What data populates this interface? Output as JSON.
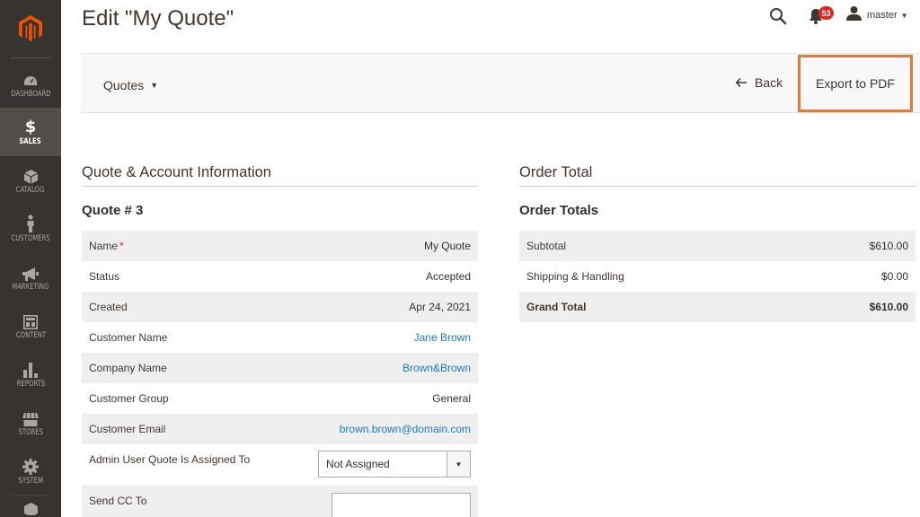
{
  "sidebar": {
    "items": [
      {
        "label": "DASHBOARD",
        "icon": "dashboard-icon"
      },
      {
        "label": "SALES",
        "icon": "dollar-icon",
        "active": true
      },
      {
        "label": "CATALOG",
        "icon": "cube-icon"
      },
      {
        "label": "CUSTOMERS",
        "icon": "person-icon"
      },
      {
        "label": "MARKETING",
        "icon": "megaphone-icon"
      },
      {
        "label": "CONTENT",
        "icon": "layout-icon"
      },
      {
        "label": "REPORTS",
        "icon": "bar-chart-icon"
      },
      {
        "label": "STORES",
        "icon": "storefront-icon"
      },
      {
        "label": "SYSTEM",
        "icon": "gear-icon"
      }
    ]
  },
  "header": {
    "title": "Edit \"My Quote\"",
    "notifications_count": "53",
    "username": "master"
  },
  "toolbar": {
    "quotes_label": "Quotes",
    "back_label": "Back",
    "export_label": "Export to PDF"
  },
  "quote_info": {
    "section_title": "Quote & Account Information",
    "subtitle": "Quote # 3",
    "rows": [
      {
        "label": "Name",
        "value": "My Quote",
        "required": true
      },
      {
        "label": "Status",
        "value": "Accepted"
      },
      {
        "label": "Created",
        "value": "Apr 24, 2021"
      },
      {
        "label": "Customer Name",
        "value": "Jane Brown",
        "link": true
      },
      {
        "label": "Company Name",
        "value": "Brown&Brown",
        "link": true
      },
      {
        "label": "Customer Group",
        "value": "General"
      },
      {
        "label": "Customer Email",
        "value": "brown.brown@domain.com",
        "link": true
      }
    ],
    "admin_user_label": "Admin User Quote Is Assigned To",
    "admin_user_value": "Not Assigned",
    "send_cc_label": "Send CC To",
    "send_cc_value": ""
  },
  "order_total": {
    "section_title": "Order Total",
    "subtitle": "Order Totals",
    "rows": [
      {
        "label": "Subtotal",
        "value": "$610.00"
      },
      {
        "label": "Shipping & Handling",
        "value": "$0.00"
      },
      {
        "label": "Grand Total",
        "value": "$610.00"
      }
    ]
  },
  "colors": {
    "sidebar_bg": "#373330",
    "accent": "#eb5202",
    "link": "#1979c3",
    "highlight_border": "#e07b39",
    "badge": "#e22626"
  }
}
